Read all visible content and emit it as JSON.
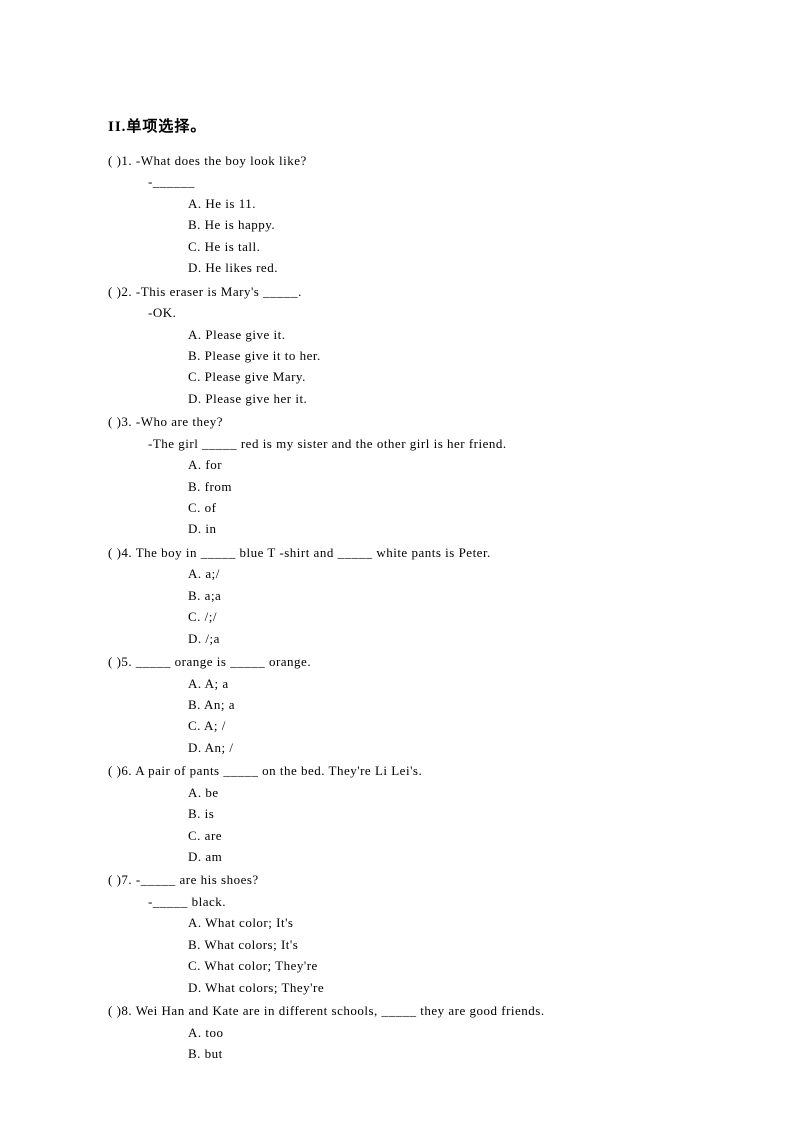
{
  "section_title": "II.单项选择。",
  "questions": [
    {
      "num": "1",
      "prompt": "-What does the boy look like?",
      "sub_lines": [
        "-______"
      ],
      "options": [
        "A. He is 11.",
        "B. He is happy.",
        "C. He is tall.",
        "D. He likes red."
      ]
    },
    {
      "num": "2",
      "prompt": "-This eraser is Mary's _____.",
      "sub_lines": [
        "-OK."
      ],
      "options": [
        "A. Please give it.",
        "B. Please give it to her.",
        "C. Please give Mary.",
        "D. Please give her it."
      ]
    },
    {
      "num": "3",
      "prompt": "-Who are they?",
      "sub_lines": [
        "-The girl _____ red is my sister and the other girl is her friend."
      ],
      "options": [
        "A. for",
        "B. from",
        "C. of",
        "D. in"
      ]
    },
    {
      "num": "4",
      "prompt": "The boy in _____ blue T -shirt and _____ white pants is Peter.",
      "sub_lines": [],
      "options": [
        "A. a;/",
        "B. a;a",
        "C. /;/",
        "D. /;a"
      ]
    },
    {
      "num": "5",
      "prompt": "_____ orange is _____ orange.",
      "sub_lines": [],
      "options": [
        "A. A; a",
        "B. An; a",
        "C. A; /",
        "D. An; /"
      ]
    },
    {
      "num": "6",
      "prompt": "A pair of pants _____ on the bed. They're Li Lei's.",
      "sub_lines": [],
      "options": [
        "A. be",
        "B. is",
        "C. are",
        "D. am"
      ]
    },
    {
      "num": "7",
      "prompt": "-_____ are his shoes?",
      "sub_lines": [
        "-_____ black."
      ],
      "options": [
        "A. What color; It's",
        "B. What colors; It's",
        "C. What color; They're",
        "D. What colors; They're"
      ]
    },
    {
      "num": "8",
      "prompt": "Wei Han and Kate are in different schools, _____ they are good friends.",
      "sub_lines": [],
      "options": [
        "A. too",
        "B. but"
      ]
    }
  ]
}
